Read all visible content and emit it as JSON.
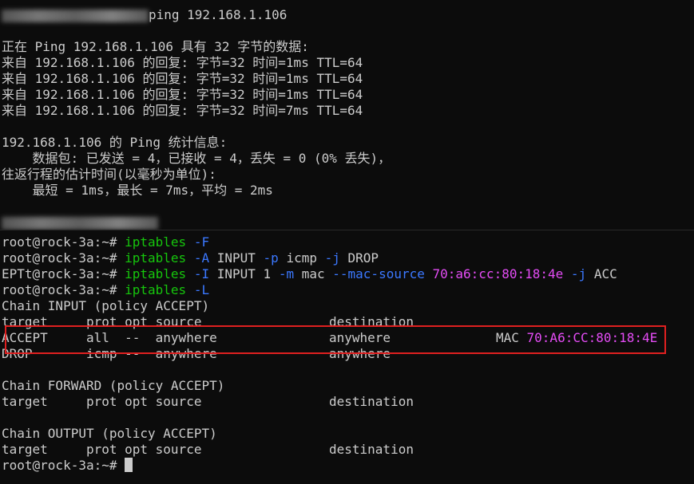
{
  "top_pane": {
    "prompt_command": "ping 192.168.1.106",
    "ping_header": "正在 Ping 192.168.1.106 具有 32 字节的数据:",
    "replies": [
      "来自 192.168.1.106 的回复: 字节=32 时间=1ms TTL=64",
      "来自 192.168.1.106 的回复: 字节=32 时间=1ms TTL=64",
      "来自 192.168.1.106 的回复: 字节=32 时间=1ms TTL=64",
      "来自 192.168.1.106 的回复: 字节=32 时间=7ms TTL=64"
    ],
    "stats_title": "192.168.1.106 的 Ping 统计信息:",
    "stats_packets": "    数据包: 已发送 = 4，已接收 = 4，丢失 = 0 (0% 丢失)，",
    "stats_rtt_title": "往返行程的估计时间(以毫秒为单位):",
    "stats_rtt": "    最短 = 1ms，最长 = 7ms，平均 = 2ms"
  },
  "bottom_pane": {
    "prompt": "root@rock-3a:~# ",
    "prompt_truncated": "EPTt@rock-3a:~# ",
    "cmd1": {
      "bin": "iptables",
      "flag": "-F"
    },
    "cmd2": {
      "bin": "iptables",
      "f1": "-A",
      "a1": "INPUT",
      "f2": "-p",
      "a2": "icmp",
      "f3": "-j",
      "a3": "DROP"
    },
    "cmd3": {
      "bin": "iptables",
      "f1": "-I",
      "a1": "INPUT 1",
      "f2": "-m",
      "a2": "mac",
      "f3": "--mac-source",
      "mac": "70:a6:cc:80:18:4e",
      "f4": "-j",
      "a4": "ACC"
    },
    "cmd4": {
      "bin": "iptables",
      "flag": "-L"
    },
    "chains": {
      "input_title": "Chain INPUT (policy ACCEPT)",
      "header_left": "target     prot opt source",
      "header_right": "destination",
      "row1_left": "ACCEPT     all  --  anywhere",
      "row1_dest": "anywhere",
      "row1_mac_label": "MAC ",
      "row1_mac": "70:A6:CC:80:18:4E",
      "row2_left": "DROP       icmp --  anywhere",
      "row2_dest": "anywhere",
      "forward_title": "Chain FORWARD (policy ACCEPT)",
      "output_title": "Chain OUTPUT (policy ACCEPT)"
    }
  },
  "colors": {
    "background": "#0c0c0c",
    "text": "#cccccc",
    "command": "#16c60c",
    "flag": "#3b78ff",
    "mac": "#e44cf5",
    "highlight": "#e02020"
  }
}
